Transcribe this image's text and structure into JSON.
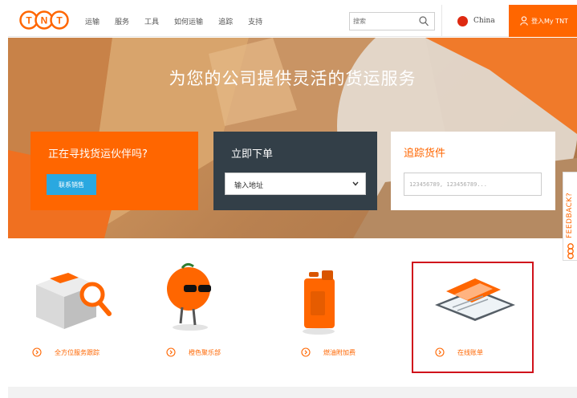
{
  "header": {
    "brand": "TNT",
    "nav": [
      "运输",
      "服务",
      "工具",
      "如何运输",
      "追踪",
      "支持"
    ],
    "search_placeholder": "搜索",
    "country": "China",
    "login": "登入My TNT"
  },
  "hero": {
    "title": "为您的公司提供灵活的货运服务",
    "partner_card": {
      "title": "正在寻找货运伙伴吗?",
      "button": "联系销售"
    },
    "order_card": {
      "title": "立即下单",
      "select_value": "输入地址"
    },
    "track_card": {
      "title": "追踪货件",
      "placeholder": "123456789, 123456789..."
    }
  },
  "feedback": {
    "label": "FEEDBACK?"
  },
  "services": [
    {
      "label": "全方位服务跟踪"
    },
    {
      "label": "橙色聚乐部"
    },
    {
      "label": "燃油附加费"
    },
    {
      "label": "在线账单"
    }
  ],
  "colors": {
    "brand_orange": "#ff6600",
    "dark_card": "#333f48",
    "button_blue": "#2aa8e0",
    "highlight_red": "#d0121b"
  }
}
